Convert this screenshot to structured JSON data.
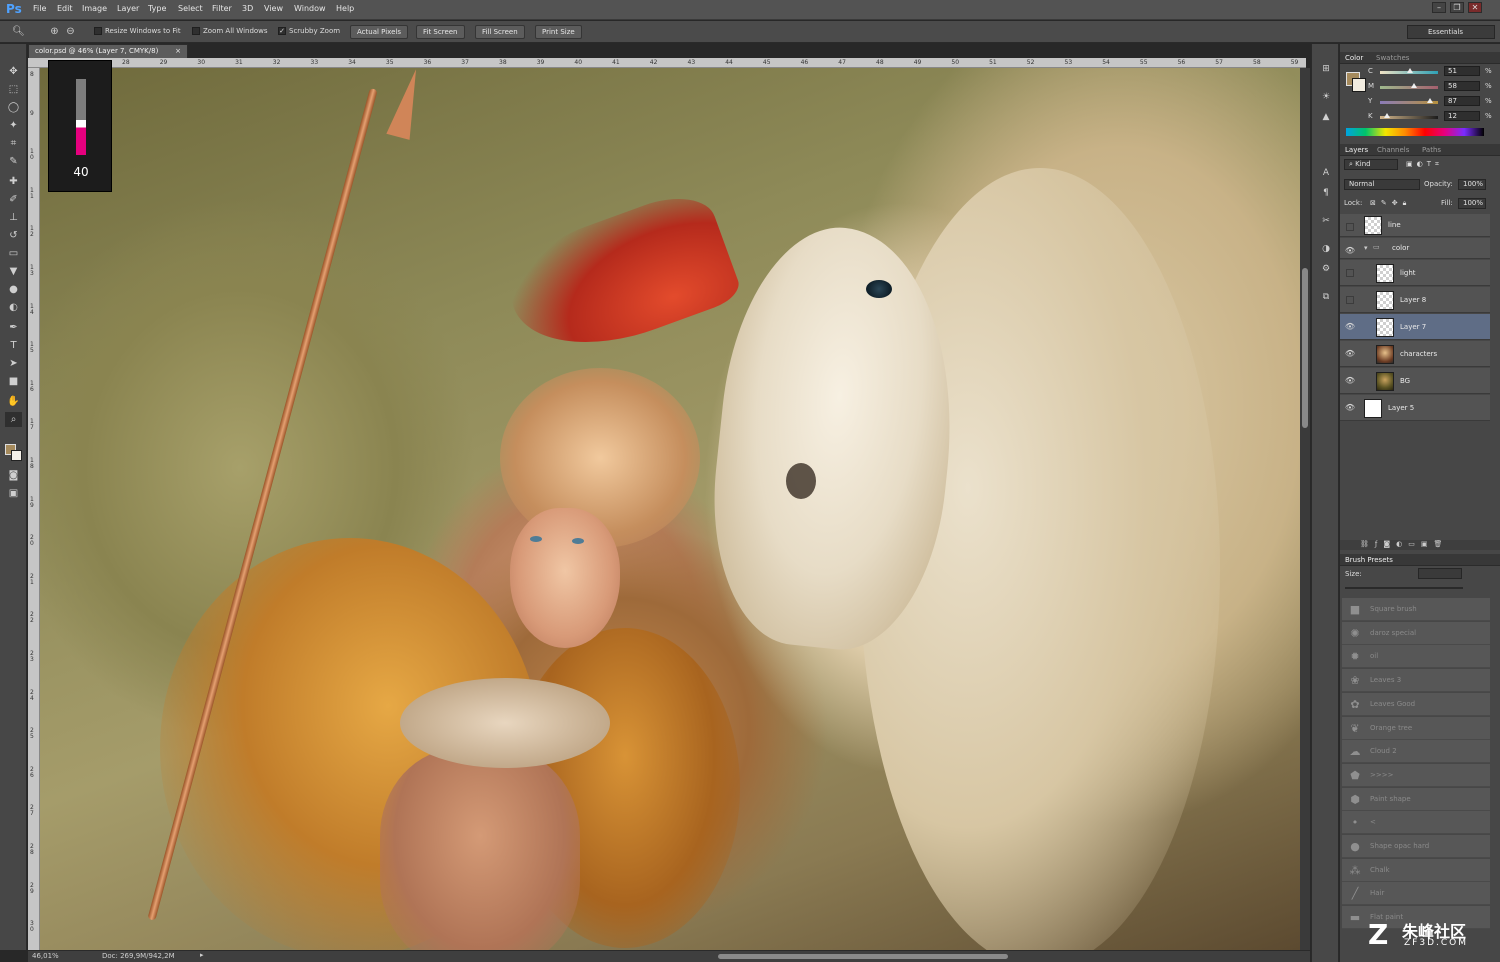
{
  "app": {
    "logo": "Ps"
  },
  "menu": [
    "File",
    "Edit",
    "Image",
    "Layer",
    "Type",
    "Select",
    "Filter",
    "3D",
    "View",
    "Window",
    "Help"
  ],
  "window_controls": {
    "minimize": "–",
    "restore": "❐",
    "close": "✕"
  },
  "options_bar": {
    "checks": [
      {
        "label": "Resize Windows to Fit",
        "checked": false
      },
      {
        "label": "Zoom All Windows",
        "checked": false
      },
      {
        "label": "Scrubby Zoom",
        "checked": true
      }
    ],
    "buttons": [
      "Actual Pixels",
      "Fit Screen",
      "Fill Screen",
      "Print Size"
    ],
    "workspace": "Essentials"
  },
  "document": {
    "tab_title": "color.psd @ 46% (Layer 7, CMYK/8)",
    "ruler_h": [
      "28",
      "29",
      "30",
      "31",
      "32",
      "33",
      "34",
      "35",
      "36",
      "37",
      "38",
      "39",
      "40",
      "41",
      "42",
      "43",
      "44",
      "45",
      "46",
      "47",
      "48",
      "49",
      "50",
      "51",
      "52",
      "53",
      "54",
      "55",
      "56",
      "57",
      "58",
      "59"
    ],
    "ruler_v": [
      "8",
      "9",
      "1 0",
      "1 1",
      "1 2",
      "1 3",
      "1 4",
      "1 5",
      "1 6",
      "1 7",
      "1 8",
      "1 9",
      "2 0",
      "2 1",
      "2 2",
      "2 3",
      "2 4",
      "2 5",
      "2 6",
      "2 7",
      "2 8",
      "2 9",
      "3 0"
    ],
    "brush_size_readout": "40",
    "brush_level_percent": 46
  },
  "status": {
    "zoom": "46,01%",
    "doc": "Doc: 269,9M/942,2M"
  },
  "color_panel": {
    "tabs": [
      "Color",
      "Swatches"
    ],
    "active_tab": "Color",
    "sliders": [
      {
        "letter": "C",
        "value": "51",
        "unit": "%",
        "level": 51,
        "gradient": "linear-gradient(90deg,#f0e2c4,#2ea0b5)"
      },
      {
        "letter": "M",
        "value": "58",
        "unit": "%",
        "level": 58,
        "gradient": "linear-gradient(90deg,#9fb98d,#a45f6e)"
      },
      {
        "letter": "Y",
        "value": "87",
        "unit": "%",
        "level": 87,
        "gradient": "linear-gradient(90deg,#8b7cb8,#b5903e)"
      },
      {
        "letter": "K",
        "value": "12",
        "unit": "%",
        "level": 12,
        "gradient": "linear-gradient(90deg,#d4b78c,#1c1c1c)"
      }
    ],
    "fg_color": "#a58a5c",
    "bg_color": "#f2ece0"
  },
  "layers_panel": {
    "tabs": [
      "Layers",
      "Channels",
      "Paths"
    ],
    "active_tab": "Layers",
    "kind_filter": "Kind",
    "blend_mode": "Normal",
    "opacity_label": "Opacity:",
    "opacity": "100%",
    "lock_label": "Lock:",
    "fill_label": "Fill:",
    "fill": "100%",
    "layers": [
      {
        "name": "line",
        "visible": false,
        "indent": false,
        "thumb": "transparent",
        "selected": false,
        "is_group": false
      },
      {
        "name": "color",
        "visible": true,
        "indent": false,
        "thumb": "folder",
        "selected": false,
        "is_group": true
      },
      {
        "name": "light",
        "visible": false,
        "indent": true,
        "thumb": "transparent",
        "selected": false,
        "is_group": false
      },
      {
        "name": "Layer 8",
        "visible": false,
        "indent": true,
        "thumb": "transparent",
        "selected": false,
        "is_group": false
      },
      {
        "name": "Layer 7",
        "visible": true,
        "indent": true,
        "thumb": "transparent",
        "selected": true,
        "is_group": false
      },
      {
        "name": "characters",
        "visible": true,
        "indent": true,
        "thumb": "characters",
        "selected": false,
        "is_group": false
      },
      {
        "name": "BG",
        "visible": true,
        "indent": true,
        "thumb": "bg",
        "selected": false,
        "is_group": false
      },
      {
        "name": "Layer 5",
        "visible": true,
        "indent": false,
        "thumb": "white",
        "selected": false,
        "is_group": false
      }
    ]
  },
  "brush_presets": {
    "title": "Brush Presets",
    "size_label": "Size:",
    "items": [
      "Square brush",
      "daroz special",
      "oil",
      "Leaves 3",
      "Leaves Good",
      "Orange tree",
      "Cloud 2",
      ">>>>",
      "Paint shape",
      "<",
      "Shape opac hard",
      "Chalk",
      "Hair",
      "Flat paint"
    ]
  },
  "watermark": {
    "logo": "Z",
    "text": "朱峰社区",
    "sub": "ZF3D.COM"
  }
}
